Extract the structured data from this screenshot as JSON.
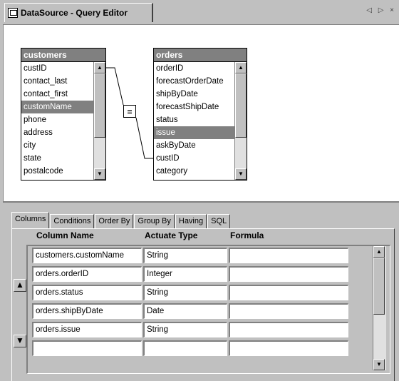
{
  "window": {
    "title": "DataSource - Query Editor",
    "nav_arrows": "◁ ▷ ×"
  },
  "diagram": {
    "tables": [
      {
        "name": "customers",
        "fields": [
          "custID",
          "contact_last",
          "contact_first",
          "customName",
          "phone",
          "address",
          "city",
          "state",
          "postalcode"
        ],
        "selected_field": "customName"
      },
      {
        "name": "orders",
        "fields": [
          "orderID",
          "forecastOrderDate",
          "shipByDate",
          "forecastShipDate",
          "status",
          "issue",
          "askByDate",
          "custID",
          "category"
        ],
        "selected_field": "issue"
      }
    ],
    "join_symbol": "="
  },
  "tabs": [
    "Columns",
    "Conditions",
    "Order By",
    "Group By",
    "Having",
    "SQL"
  ],
  "active_tab": "Columns",
  "grid": {
    "headers": [
      "Column Name",
      "Actuate Type",
      "Formula"
    ],
    "rows": [
      {
        "column": "customers.customName",
        "type": "String",
        "formula": ""
      },
      {
        "column": "orders.orderID",
        "type": "Integer",
        "formula": ""
      },
      {
        "column": "orders.status",
        "type": "String",
        "formula": ""
      },
      {
        "column": "orders.shipByDate",
        "type": "Date",
        "formula": ""
      },
      {
        "column": "orders.issue",
        "type": "String",
        "formula": ""
      },
      {
        "column": "",
        "type": "",
        "formula": ""
      }
    ],
    "move_up_label": "🡅",
    "move_down_label": "🡇"
  }
}
